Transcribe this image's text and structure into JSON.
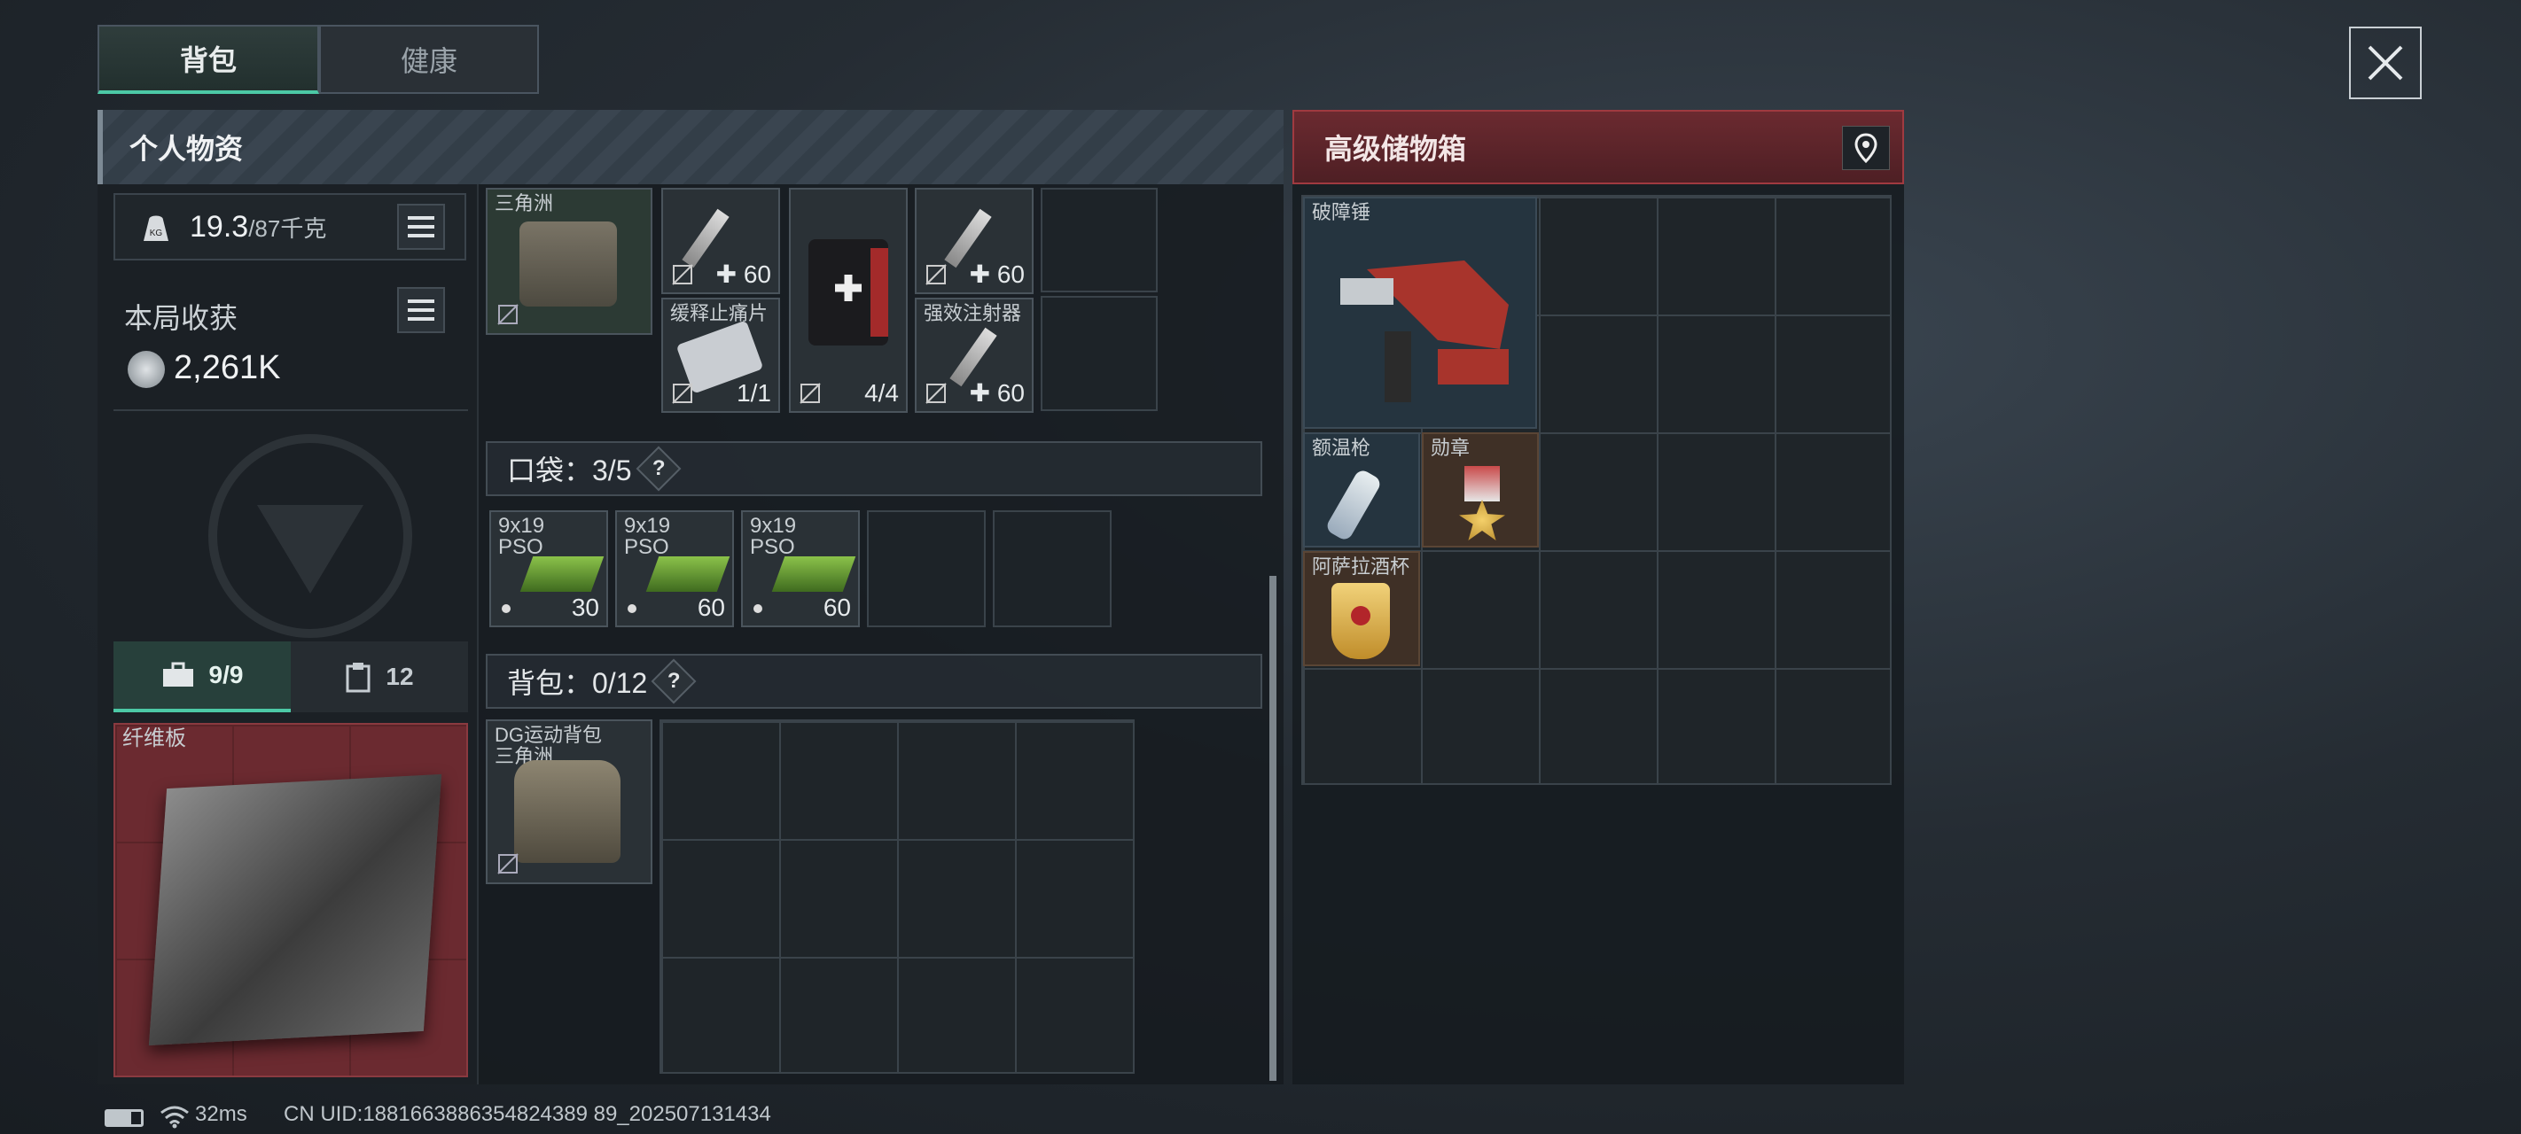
{
  "tabs": [
    {
      "label": "背包"
    },
    {
      "label": "健康"
    }
  ],
  "personal": {
    "title": "个人物资",
    "weight_value": "19.3",
    "weight_max": "/87千克",
    "weight_unit_icon": "KG",
    "earnings_label": "本局收获",
    "earnings_value": "2,261K"
  },
  "equipment_tabs": [
    {
      "label": "9/9",
      "icon": "toolbox-icon"
    },
    {
      "label": "12",
      "icon": "clipboard-icon"
    }
  ],
  "armor": {
    "label": "纤维板"
  },
  "rig": {
    "label_lines": [
      "三角洲"
    ]
  },
  "rig_items": [
    {
      "label": "",
      "value": "60",
      "type": "injector"
    },
    {
      "label": "缓释止痛片",
      "value": "1/1",
      "type": "pills"
    },
    {
      "label": "",
      "value": "4/4",
      "type": "medkit"
    },
    {
      "label": "",
      "value": "60",
      "type": "injector"
    },
    {
      "label": "强效注射器",
      "value": "60",
      "type": "injector"
    }
  ],
  "pockets": {
    "label": "口袋：3/5",
    "help": "?",
    "items": [
      {
        "name": "9x19\nPSO",
        "value": "30"
      },
      {
        "name": "9x19\nPSO",
        "value": "60"
      },
      {
        "name": "9x19\nPSO",
        "value": "60"
      }
    ]
  },
  "backpack": {
    "label": "背包：0/12",
    "help": "?",
    "item": {
      "name": "DG运动背包\n三角洲"
    }
  },
  "storage": {
    "title": "高级储物箱",
    "items": [
      {
        "name": "破障锤"
      },
      {
        "name": "额温枪"
      },
      {
        "name": "勋章"
      },
      {
        "name": "阿萨拉酒杯"
      }
    ]
  },
  "status": {
    "ping": "32ms",
    "uid": "CN UID:1881663886354824389 89_202507131434"
  },
  "colors": {
    "accent_green": "#4cc9a6",
    "storage_red": "#6b2a30",
    "armor_red": "#7a2f33"
  }
}
